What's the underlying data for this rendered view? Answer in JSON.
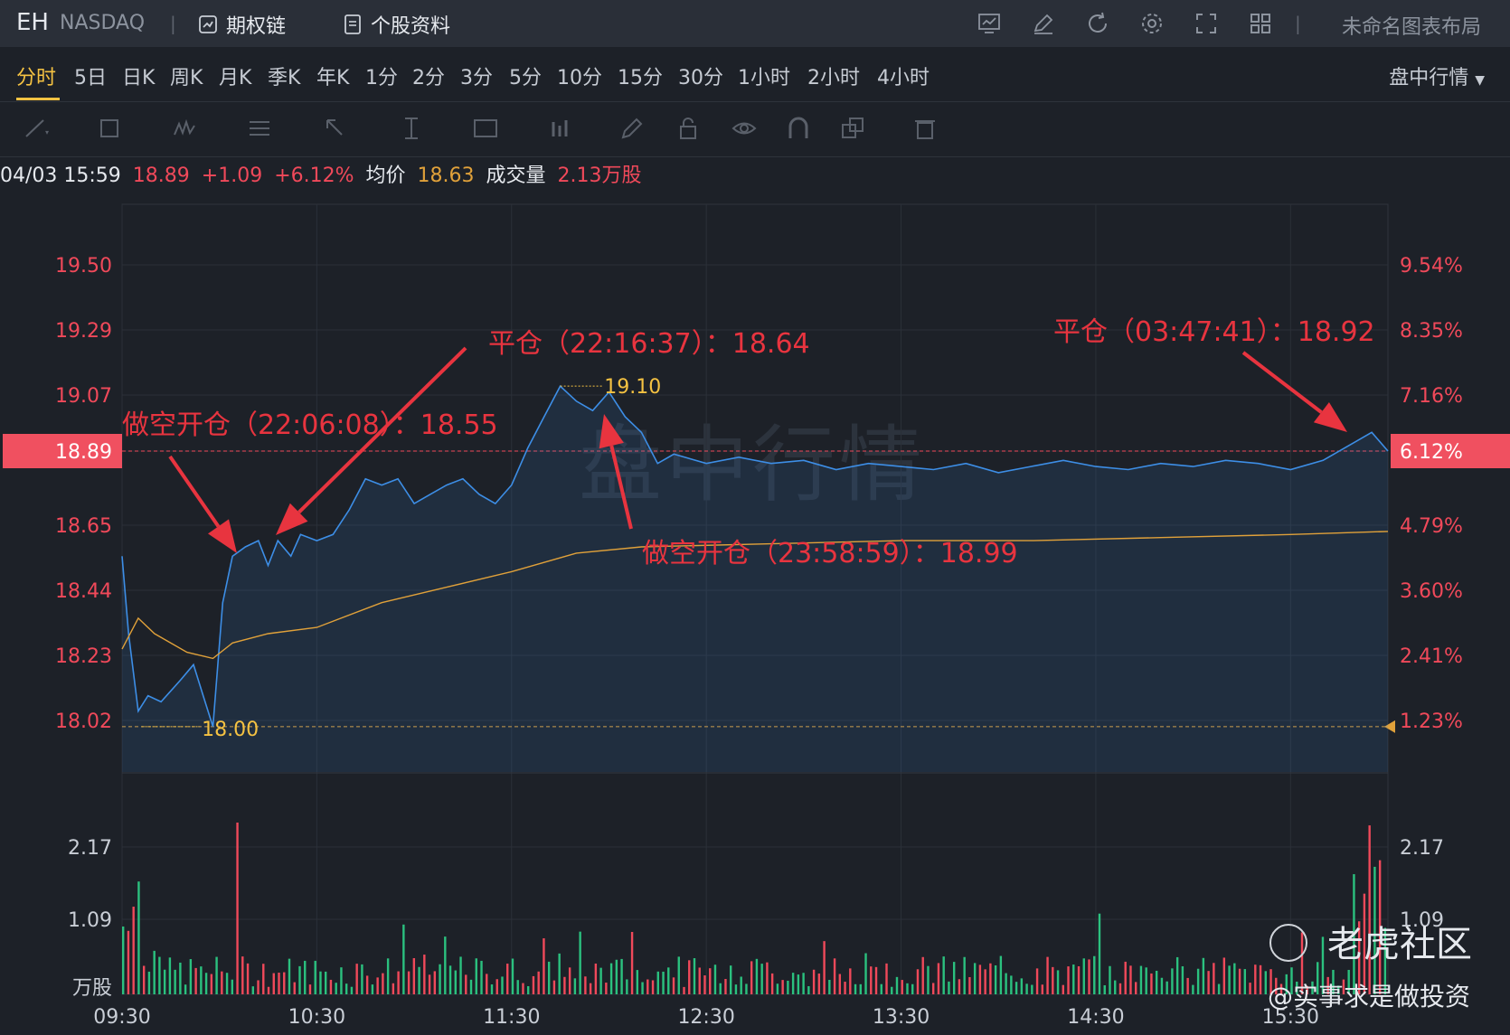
{
  "header": {
    "symbol": "EH",
    "exchange": "NASDAQ",
    "options_chain": "期权链",
    "stock_info": "个股资料",
    "layout_name": "未命名图表布局"
  },
  "timeframes": [
    "分时",
    "5日",
    "日K",
    "周K",
    "月K",
    "季K",
    "年K",
    "1分",
    "2分",
    "3分",
    "5分",
    "10分",
    "15分",
    "30分",
    "1小时",
    "2小时",
    "4小时"
  ],
  "active_timeframe": "分时",
  "session_dropdown": "盘中行情",
  "info": {
    "datetime": "04/03 15:59",
    "price": "18.89",
    "change": "+1.09",
    "change_pct": "+6.12%",
    "avg_label": "均价",
    "avg_value": "18.63",
    "vol_label": "成交量",
    "vol_value": "2.13万股"
  },
  "watermark": "盘中行情",
  "annotations": [
    {
      "text": "平仓（22:16:37）：18.64"
    },
    {
      "text": "做空开仓（22:06:08）：18.55"
    },
    {
      "text": "做空开仓（23:58:59）：18.99"
    },
    {
      "text": "平仓（03:47:41）：18.92"
    }
  ],
  "colors": {
    "price_line": "#3d8ee6",
    "avg_line": "#e0a13a",
    "up": "#f0495a",
    "down": "#2bc17f",
    "accent": "#f5c242"
  },
  "chart_data": {
    "type": "line",
    "price_ticks_left": [
      "19.50",
      "19.29",
      "19.07",
      "18.89",
      "18.65",
      "18.44",
      "18.23",
      "18.02"
    ],
    "pct_ticks_right": [
      "9.54%",
      "8.35%",
      "7.16%",
      "6.12%",
      "4.79%",
      "3.60%",
      "2.41%",
      "1.23%"
    ],
    "ylim": [
      18.02,
      19.5
    ],
    "current_price": "18.89",
    "high_label": "19.10",
    "low_label": "18.00",
    "x_ticks": [
      "09:30",
      "10:30",
      "11:30",
      "12:30",
      "13:30",
      "14:30",
      "15:30"
    ],
    "volume_ticks": [
      "2.17",
      "1.09"
    ],
    "volume_unit": "万股",
    "series": [
      {
        "name": "price",
        "points": [
          [
            0,
            18.55
          ],
          [
            2,
            18.3
          ],
          [
            5,
            18.05
          ],
          [
            8,
            18.1
          ],
          [
            12,
            18.08
          ],
          [
            18,
            18.15
          ],
          [
            22,
            18.2
          ],
          [
            25,
            18.1
          ],
          [
            28,
            18.0
          ],
          [
            31,
            18.4
          ],
          [
            34,
            18.55
          ],
          [
            38,
            18.58
          ],
          [
            42,
            18.6
          ],
          [
            45,
            18.52
          ],
          [
            48,
            18.6
          ],
          [
            52,
            18.55
          ],
          [
            55,
            18.62
          ],
          [
            60,
            18.6
          ],
          [
            65,
            18.62
          ],
          [
            70,
            18.7
          ],
          [
            75,
            18.8
          ],
          [
            80,
            18.78
          ],
          [
            85,
            18.8
          ],
          [
            90,
            18.72
          ],
          [
            95,
            18.75
          ],
          [
            100,
            18.78
          ],
          [
            105,
            18.8
          ],
          [
            110,
            18.75
          ],
          [
            115,
            18.72
          ],
          [
            120,
            18.78
          ],
          [
            125,
            18.9
          ],
          [
            130,
            19.0
          ],
          [
            135,
            19.1
          ],
          [
            140,
            19.05
          ],
          [
            145,
            19.02
          ],
          [
            150,
            19.08
          ],
          [
            155,
            19.0
          ],
          [
            160,
            18.95
          ],
          [
            165,
            18.85
          ],
          [
            170,
            18.88
          ],
          [
            180,
            18.85
          ],
          [
            190,
            18.87
          ],
          [
            200,
            18.85
          ],
          [
            210,
            18.86
          ],
          [
            220,
            18.83
          ],
          [
            230,
            18.85
          ],
          [
            240,
            18.84
          ],
          [
            250,
            18.83
          ],
          [
            260,
            18.85
          ],
          [
            270,
            18.82
          ],
          [
            280,
            18.84
          ],
          [
            290,
            18.86
          ],
          [
            300,
            18.84
          ],
          [
            310,
            18.83
          ],
          [
            320,
            18.85
          ],
          [
            330,
            18.84
          ],
          [
            340,
            18.86
          ],
          [
            350,
            18.85
          ],
          [
            360,
            18.83
          ],
          [
            370,
            18.86
          ],
          [
            380,
            18.92
          ],
          [
            385,
            18.95
          ],
          [
            390,
            18.89
          ]
        ]
      },
      {
        "name": "avg",
        "points": [
          [
            0,
            18.25
          ],
          [
            5,
            18.35
          ],
          [
            10,
            18.3
          ],
          [
            20,
            18.24
          ],
          [
            28,
            18.22
          ],
          [
            34,
            18.27
          ],
          [
            45,
            18.3
          ],
          [
            60,
            18.32
          ],
          [
            80,
            18.4
          ],
          [
            100,
            18.45
          ],
          [
            120,
            18.5
          ],
          [
            140,
            18.56
          ],
          [
            160,
            18.58
          ],
          [
            200,
            18.59
          ],
          [
            240,
            18.6
          ],
          [
            280,
            18.6
          ],
          [
            320,
            18.61
          ],
          [
            360,
            18.62
          ],
          [
            390,
            18.63
          ]
        ]
      }
    ],
    "volume_up_color": "#f0495a",
    "volume_down_color": "#2bc17f"
  },
  "brand": {
    "name": "老虎社区",
    "handle": "@实事求是做投资"
  }
}
